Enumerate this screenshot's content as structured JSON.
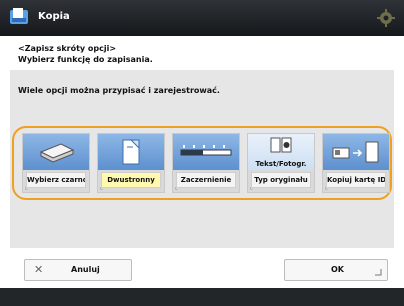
{
  "app": {
    "title": "Kopia"
  },
  "breadcrumb": {
    "path": "<Zapisz skróty opcji>",
    "hint": "Wybierz funkcję do zapisania."
  },
  "instruction": "Wiele opcji można przypisać i zarejestrować.",
  "options": [
    {
      "label": "Wybierz czarno",
      "selected": false,
      "icon": "paper-stack-icon"
    },
    {
      "label": "Dwustronny",
      "selected": true,
      "icon": "duplex-page-icon"
    },
    {
      "label": "Zaczernienie",
      "selected": false,
      "icon": "density-bar-icon"
    },
    {
      "label": "Typ oryginału",
      "selected": false,
      "icon": "text-photo-icon",
      "sub_label": "Tekst/Fotogr."
    },
    {
      "label": "Kopiuj kartę ID",
      "selected": false,
      "icon": "id-card-icon"
    }
  ],
  "footer": {
    "cancel_label": "Anuluj",
    "ok_label": "OK"
  },
  "colors": {
    "highlight": "#f0a020",
    "titlebar": "#1d2124",
    "tile": "#6f9fd8"
  }
}
